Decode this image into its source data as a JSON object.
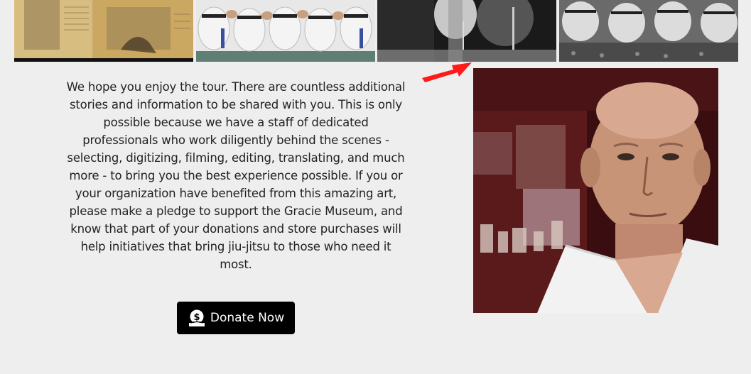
{
  "intro": {
    "text": "We hope you enjoy the tour. There are countless additional stories and information to be shared with you. This is only possible because we have a staff of dedicated professionals who work diligently behind the scenes - selecting, digitizing, filming, editing, translating, and much more - to bring you the best experience possible. If you or your organization have benefited from this amazing art, please make a pledge to support the Gracie Museum, and know that part of your donations and store purchases will help initiatives that bring jiu-jitsu to those who need it most."
  },
  "donate": {
    "label": "Donate Now",
    "icon": "money-bag-icon"
  },
  "photos": {
    "icons": [
      "newspaper-clipping-photo",
      "group-photo-kneeling",
      "vintage-fight-photo",
      "group-photo-seated"
    ]
  },
  "portrait": {
    "icon": "elder-portrait-photo"
  },
  "arrow": {
    "icon": "red-arrow-icon",
    "color": "#ff1a1a"
  }
}
